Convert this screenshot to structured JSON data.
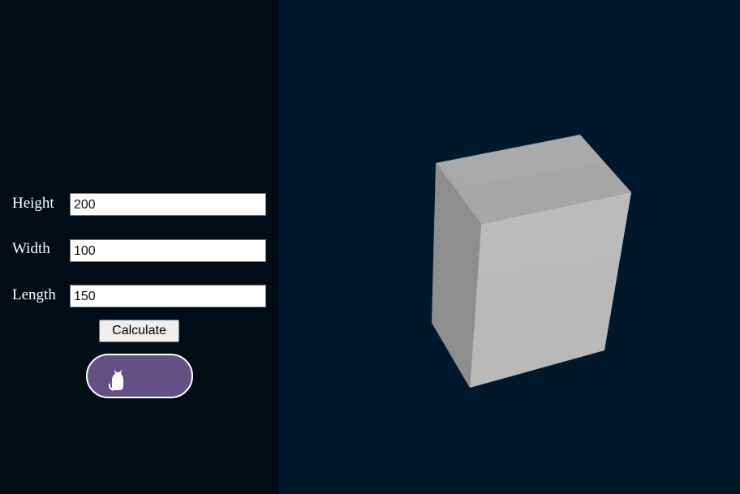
{
  "form": {
    "height": {
      "label": "Height",
      "value": "200"
    },
    "width": {
      "label": "Width",
      "value": "100"
    },
    "length": {
      "label": "Length",
      "value": "150"
    },
    "calculate_label": "Calculate"
  },
  "logo": {
    "icon": "cat-moon-logo-icon"
  },
  "colors": {
    "sidebar_background": "#010c14",
    "viewport_background": "#00182c",
    "logo_pill": "#645183",
    "cube_top": "#a6a6a6",
    "cube_front": "#b8b8b8",
    "cube_side": "#8c8c8c"
  }
}
